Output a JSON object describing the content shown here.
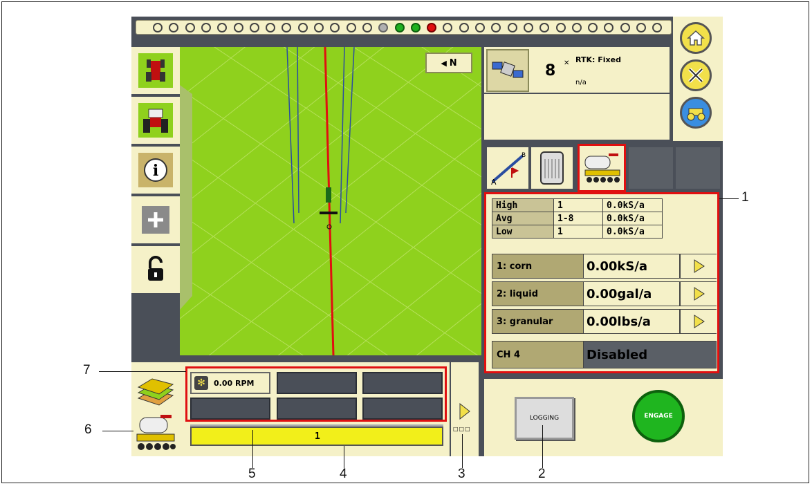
{
  "gps": {
    "satellites": "8",
    "status": "RTK: Fixed",
    "detail": "n/a"
  },
  "map": {
    "north_label": "N"
  },
  "channels": {
    "summary": [
      {
        "label": "High",
        "range": "1",
        "value": "0.0kS/a"
      },
      {
        "label": "Avg",
        "range": "1-8",
        "value": "0.0kS/a"
      },
      {
        "label": "Low",
        "range": "1",
        "value": "0.0kS/a"
      }
    ],
    "rows": [
      {
        "name": "1: corn",
        "rate": "0.00kS/a"
      },
      {
        "name": "2: liquid",
        "rate": "0.00gal/a"
      },
      {
        "name": "3: granular",
        "rate": "0.00lbs/a"
      },
      {
        "name": "CH 4",
        "rate": "Disabled"
      }
    ]
  },
  "bottom": {
    "rpm_label": "0.00 RPM",
    "progress_label": "1"
  },
  "buttons": {
    "logging": "LOGGING",
    "engage": "ENGAGE"
  },
  "callouts": [
    "1",
    "2",
    "3",
    "4",
    "5",
    "6",
    "7"
  ],
  "colors": {
    "field": "#8fd11d",
    "panel": "#f5f1c8",
    "highlight": "#e01010",
    "engage": "#1fb51f"
  }
}
